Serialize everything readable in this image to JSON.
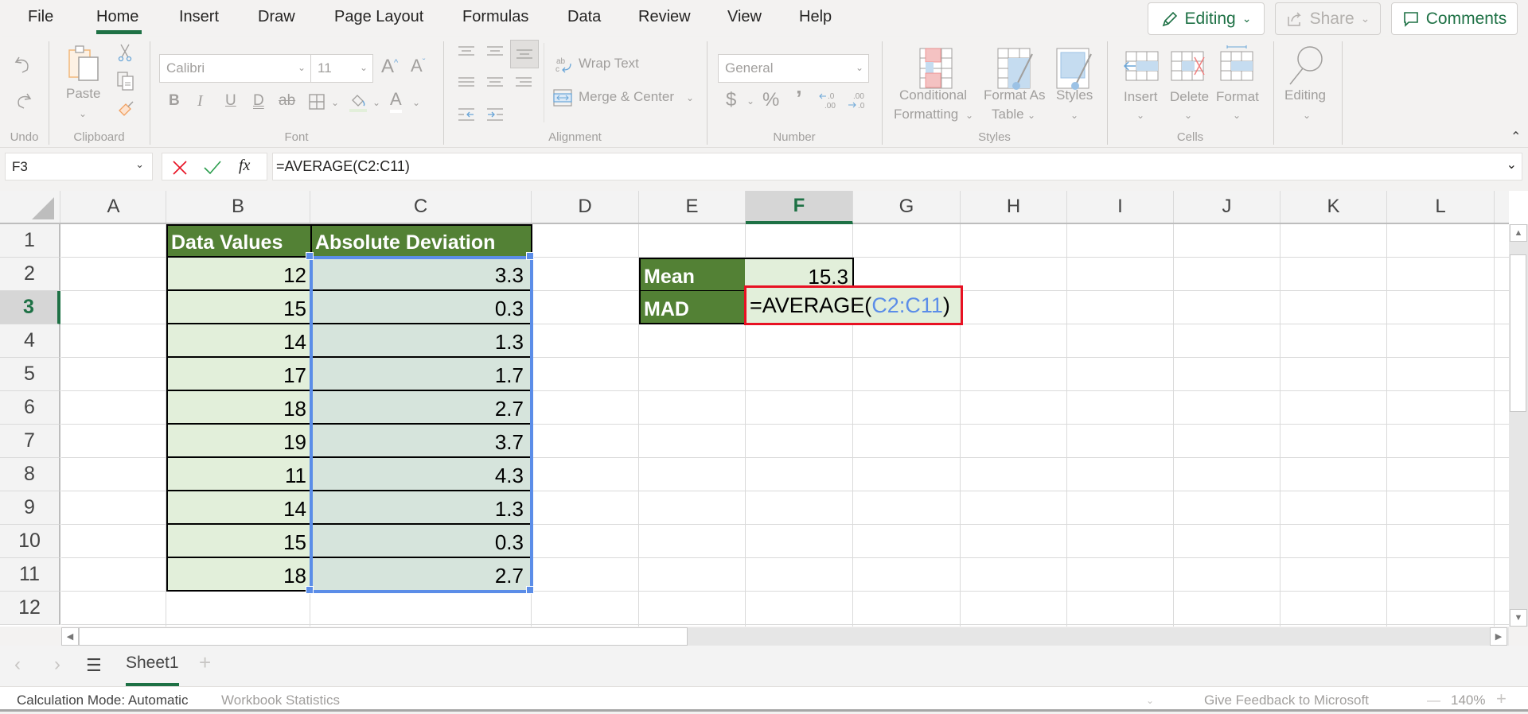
{
  "menu": {
    "tabs": [
      "File",
      "Home",
      "Insert",
      "Draw",
      "Page Layout",
      "Formulas",
      "Data",
      "Review",
      "View",
      "Help"
    ],
    "active_tab": "Home",
    "editing_button": "Editing",
    "share_button": "Share",
    "comments_button": "Comments"
  },
  "ribbon": {
    "undo": {
      "label": "Undo"
    },
    "clipboard": {
      "label": "Clipboard",
      "paste": "Paste"
    },
    "font": {
      "label": "Font",
      "font_name": "Calibri",
      "font_size": "11",
      "bold": "B",
      "italic": "I",
      "underline": "U",
      "double_underline": "D",
      "strikethrough": "ab",
      "font_color": "A"
    },
    "alignment": {
      "label": "Alignment",
      "wrap_text": "Wrap Text",
      "merge_center": "Merge & Center"
    },
    "number": {
      "label": "Number",
      "format": "General",
      "currency": "$",
      "percent": "%",
      "comma": "’"
    },
    "styles": {
      "label": "Styles",
      "conditional_1": "Conditional",
      "conditional_2": "Formatting",
      "format_as_1": "Format As",
      "format_as_2": "Table",
      "cell_styles": "Styles"
    },
    "cells": {
      "label": "Cells",
      "insert": "Insert",
      "delete": "Delete",
      "format": "Format"
    },
    "editing": {
      "label": "Editing"
    }
  },
  "formula_bar": {
    "name_box": "F3",
    "formula": "=AVERAGE(C2:C11)"
  },
  "grid": {
    "columns": [
      "A",
      "B",
      "C",
      "D",
      "E",
      "F",
      "G",
      "H",
      "I",
      "J",
      "K",
      "L"
    ],
    "rows": [
      "1",
      "2",
      "3",
      "4",
      "5",
      "6",
      "7",
      "8",
      "9",
      "10",
      "11",
      "12"
    ],
    "selected_column": "F",
    "selected_row": "3",
    "table_headers": {
      "B1": "Data Values",
      "C1": "Absolute Deviation"
    },
    "data_values": [
      "12",
      "15",
      "14",
      "17",
      "18",
      "19",
      "11",
      "14",
      "15",
      "18"
    ],
    "absolute_deviation": [
      "3.3",
      "0.3",
      "1.3",
      "1.7",
      "2.7",
      "3.7",
      "4.3",
      "1.3",
      "0.3",
      "2.7"
    ],
    "summary": {
      "mean_label": "Mean",
      "mean_value": "15.3",
      "mad_label": "MAD",
      "mad_formula_prefix": "=AVERAGE(",
      "mad_formula_ref": "C2:C11",
      "mad_formula_suffix": ")"
    }
  },
  "sheets": {
    "tabs": [
      "Sheet1"
    ],
    "active": "Sheet1"
  },
  "status_bar": {
    "calc_mode": "Calculation Mode: Automatic",
    "workbook_stats": "Workbook Statistics",
    "feedback": "Give Feedback to Microsoft",
    "zoom": "140%"
  },
  "colors": {
    "accent": "#1e7145",
    "header_fill": "#538135",
    "data_fill": "#e2efda",
    "selection": "#5b8de8",
    "edit_border": "#e81123"
  }
}
